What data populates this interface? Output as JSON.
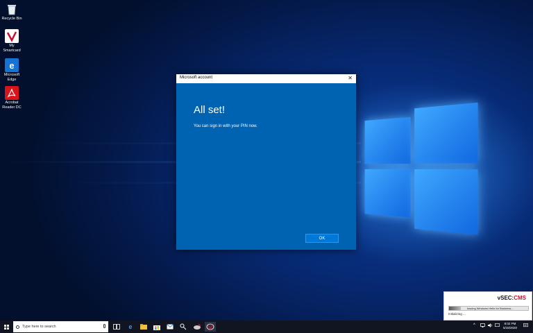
{
  "desktop": {
    "icons": [
      {
        "label": "Recycle Bin",
        "icon": "recycle-bin-icon"
      },
      {
        "label": "My Smartcard",
        "icon": "smartcard-icon"
      },
      {
        "label": "Microsoft Edge",
        "icon": "edge-icon"
      },
      {
        "label": "Acrobat Reader DC",
        "icon": "acrobat-icon"
      }
    ]
  },
  "dialog": {
    "title": "Microsoft account",
    "heading": "All set!",
    "message": "You can sign in with your PIN now.",
    "ok_label": "OK",
    "close_glyph": "✕"
  },
  "toast": {
    "brand_a": "vSEC:",
    "brand_b": "CMS",
    "progress_text": "Issuing Windows Hello for Business...",
    "progress": 0.15,
    "status": "Initializing ..."
  },
  "taskbar": {
    "search_placeholder": "Type here to search",
    "tray_chevron": "^",
    "clock_time": "8:02 PM",
    "clock_date": "5/18/2020"
  },
  "colors": {
    "dialog_bg": "#0063b1",
    "button_bg": "#0078d7",
    "brand_red": "#c8102e"
  }
}
